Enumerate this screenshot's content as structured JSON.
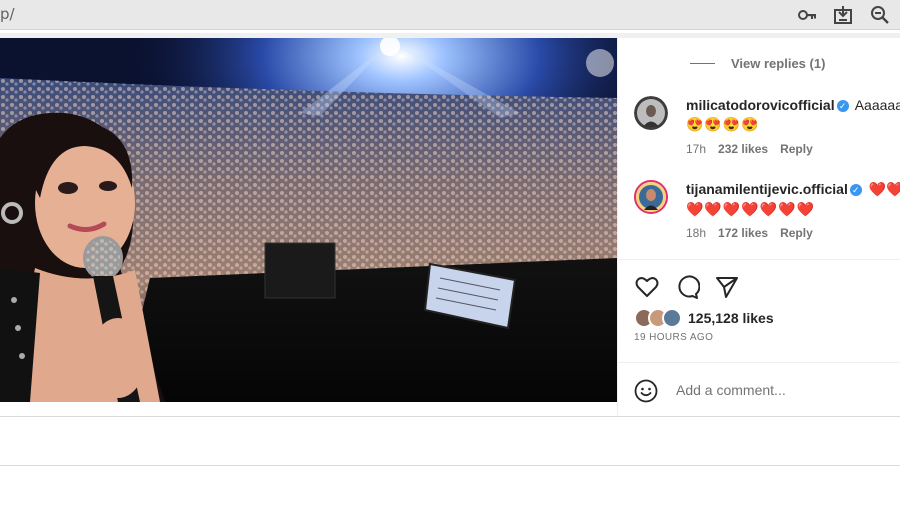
{
  "browser": {
    "url_fragment": "p/",
    "icons": [
      "key-icon",
      "install-app-icon",
      "zoom-out-icon"
    ]
  },
  "post": {
    "view_replies": "View replies (1)",
    "comments": [
      {
        "username": "milicatodorovicofficial",
        "text": "Aaaaaaa",
        "emojis": "😍😍😍😍",
        "time": "17h",
        "likes": "232 likes",
        "reply": "Reply"
      },
      {
        "username": "tijanamilentijevic.official",
        "text": "❤️❤️",
        "emojis": "❤️❤️❤️❤️❤️❤️❤️",
        "time": "18h",
        "likes": "172 likes",
        "reply": "Reply"
      }
    ],
    "likes": "125,128 likes",
    "time_ago": "19 HOURS AGO",
    "add_comment_placeholder": "Add a comment..."
  },
  "colors": {
    "accent": "#3897f0",
    "muted": "#737373",
    "text": "#262626"
  }
}
